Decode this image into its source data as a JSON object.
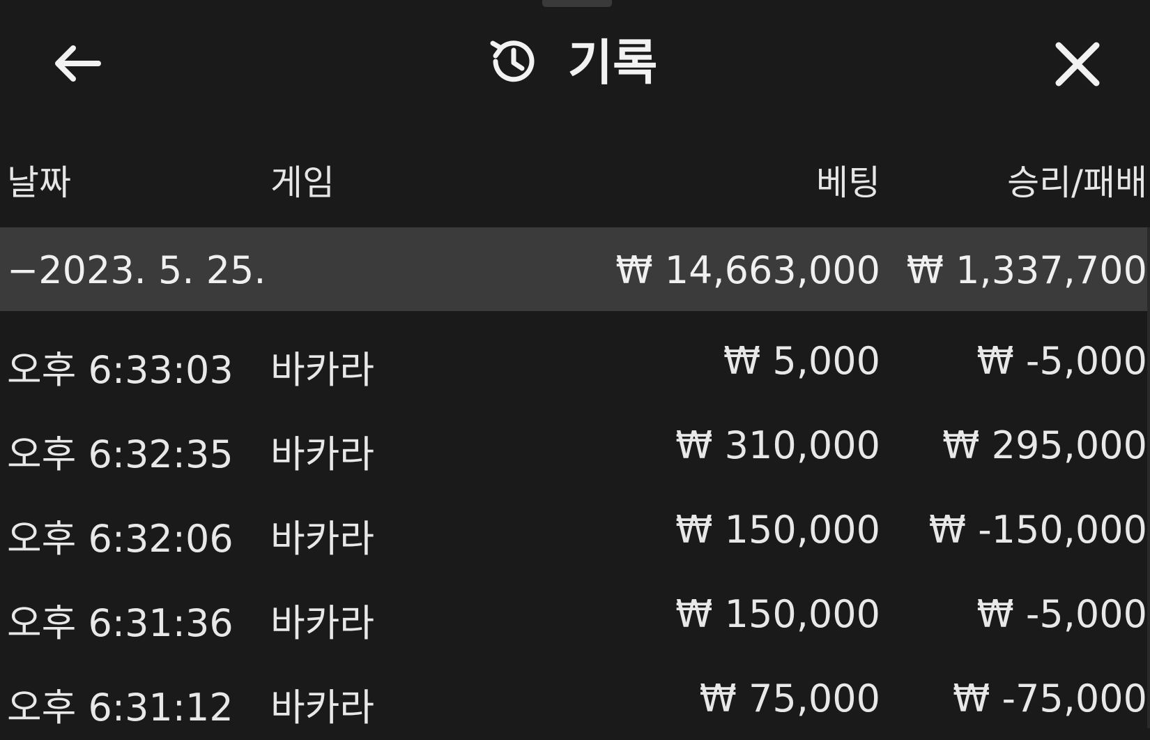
{
  "header": {
    "title": "기록",
    "back_icon": "arrow-left-icon",
    "history_icon": "history-icon",
    "close_icon": "close-icon"
  },
  "columns": {
    "date": "날짜",
    "game": "게임",
    "bet": "베팅",
    "result": "승리/패배"
  },
  "summary": {
    "date": "−2023. 5. 25.",
    "bet": "₩ 14,663,000",
    "result": "₩ 1,337,700"
  },
  "rows": [
    {
      "time": "오후 6:33:03",
      "game": "바카라",
      "bet": "₩ 5,000",
      "result": "₩ -5,000"
    },
    {
      "time": "오후 6:32:35",
      "game": "바카라",
      "bet": "₩ 310,000",
      "result": "₩ 295,000"
    },
    {
      "time": "오후 6:32:06",
      "game": "바카라",
      "bet": "₩ 150,000",
      "result": "₩ -150,000"
    },
    {
      "time": "오후 6:31:36",
      "game": "바카라",
      "bet": "₩ 150,000",
      "result": "₩ -5,000"
    },
    {
      "time": "오후 6:31:12",
      "game": "바카라",
      "bet": "₩ 75,000",
      "result": "₩ -75,000"
    }
  ],
  "colors": {
    "background": "#1a1a1a",
    "summary_row": "#3b3b3b",
    "text": "#ececec"
  }
}
